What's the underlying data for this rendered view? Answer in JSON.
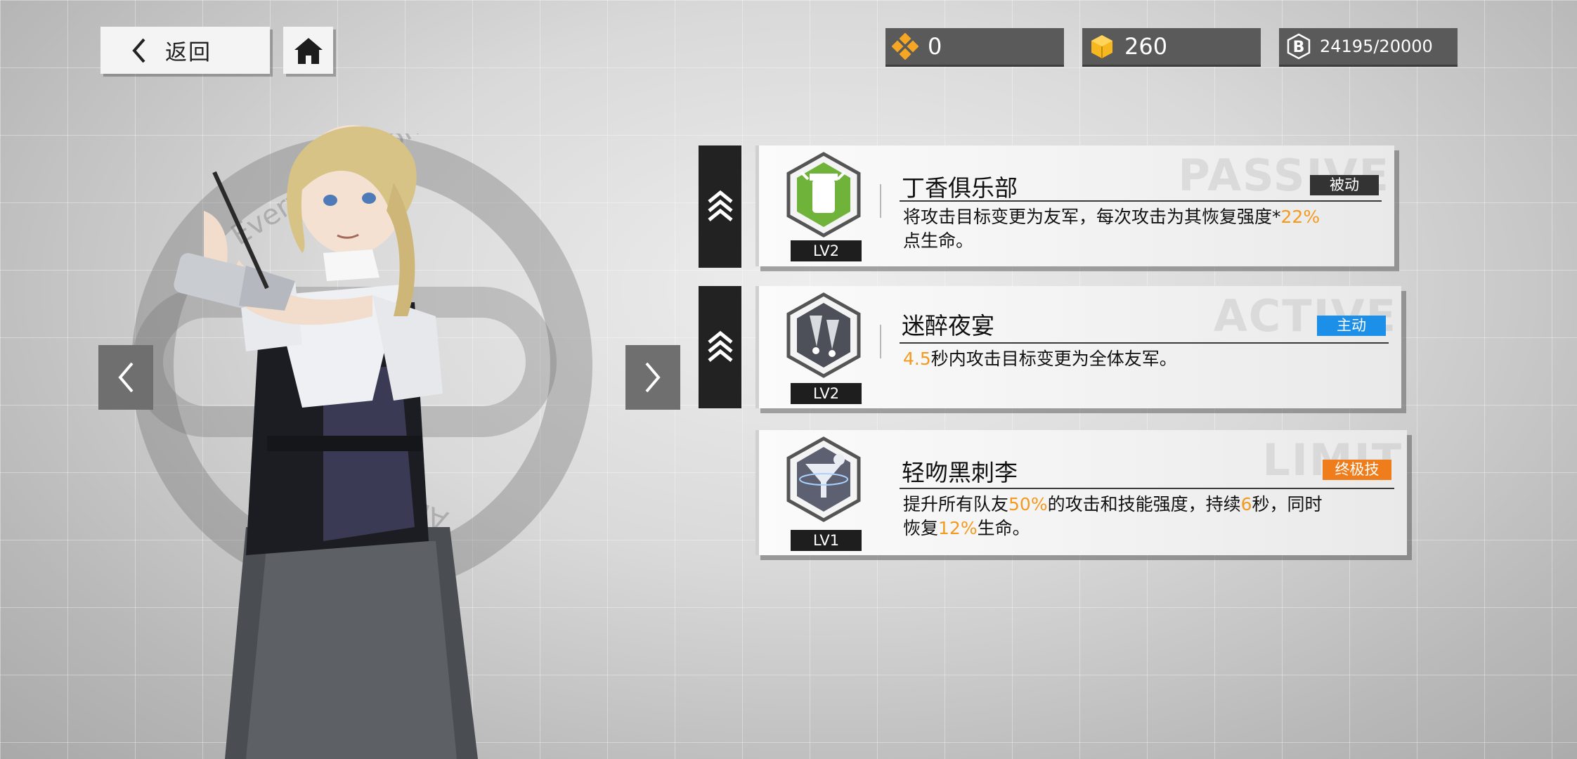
{
  "header": {
    "back_label": "返回",
    "icons": {
      "back": "chevron-left-icon",
      "home": "home-icon"
    }
  },
  "currencies": [
    {
      "icon": "orange-gem-icon",
      "value": "0"
    },
    {
      "icon": "gold-cube-icon",
      "value": "260"
    },
    {
      "icon": "b-coin-icon",
      "value": "24195/20000"
    }
  ],
  "emblem_text": {
    "top": "Everything Company",
    "bottom": "Any House"
  },
  "skills": [
    {
      "name": "丁香俱乐部",
      "level": "LV2",
      "type": "被动",
      "type_color": "#333333",
      "watermark": "PASSIVE",
      "desc_lines": [
        [
          {
            "t": "将攻击目标变更为友军，每次攻击为其恢复强度*"
          },
          {
            "t": "22%",
            "hl": true
          }
        ],
        [
          {
            "t": "点生命。"
          }
        ]
      ]
    },
    {
      "name": "迷醉夜宴",
      "level": "LV2",
      "type": "主动",
      "type_color": "#1c8fe8",
      "watermark": "ACTIVE",
      "desc_lines": [
        [
          {
            "t": "4.5",
            "hl": true
          },
          {
            "t": "秒内攻击目标变更为全体友军。"
          }
        ]
      ]
    },
    {
      "name": "轻吻黑刺李",
      "level": "LV1",
      "type": "终极技",
      "type_color": "#f07d1c",
      "watermark": "LIMIT",
      "desc_lines": [
        [
          {
            "t": "提升所有队友"
          },
          {
            "t": "50%",
            "hl": true
          },
          {
            "t": "的攻击和技能强度，持续"
          },
          {
            "t": "6",
            "hl": true
          },
          {
            "t": "秒，同时"
          }
        ],
        [
          {
            "t": "恢复"
          },
          {
            "t": "12%",
            "hl": true
          },
          {
            "t": "生命。"
          }
        ]
      ]
    }
  ],
  "colors": {
    "highlight": "#f39a1f",
    "panel_dark": "#222222"
  }
}
